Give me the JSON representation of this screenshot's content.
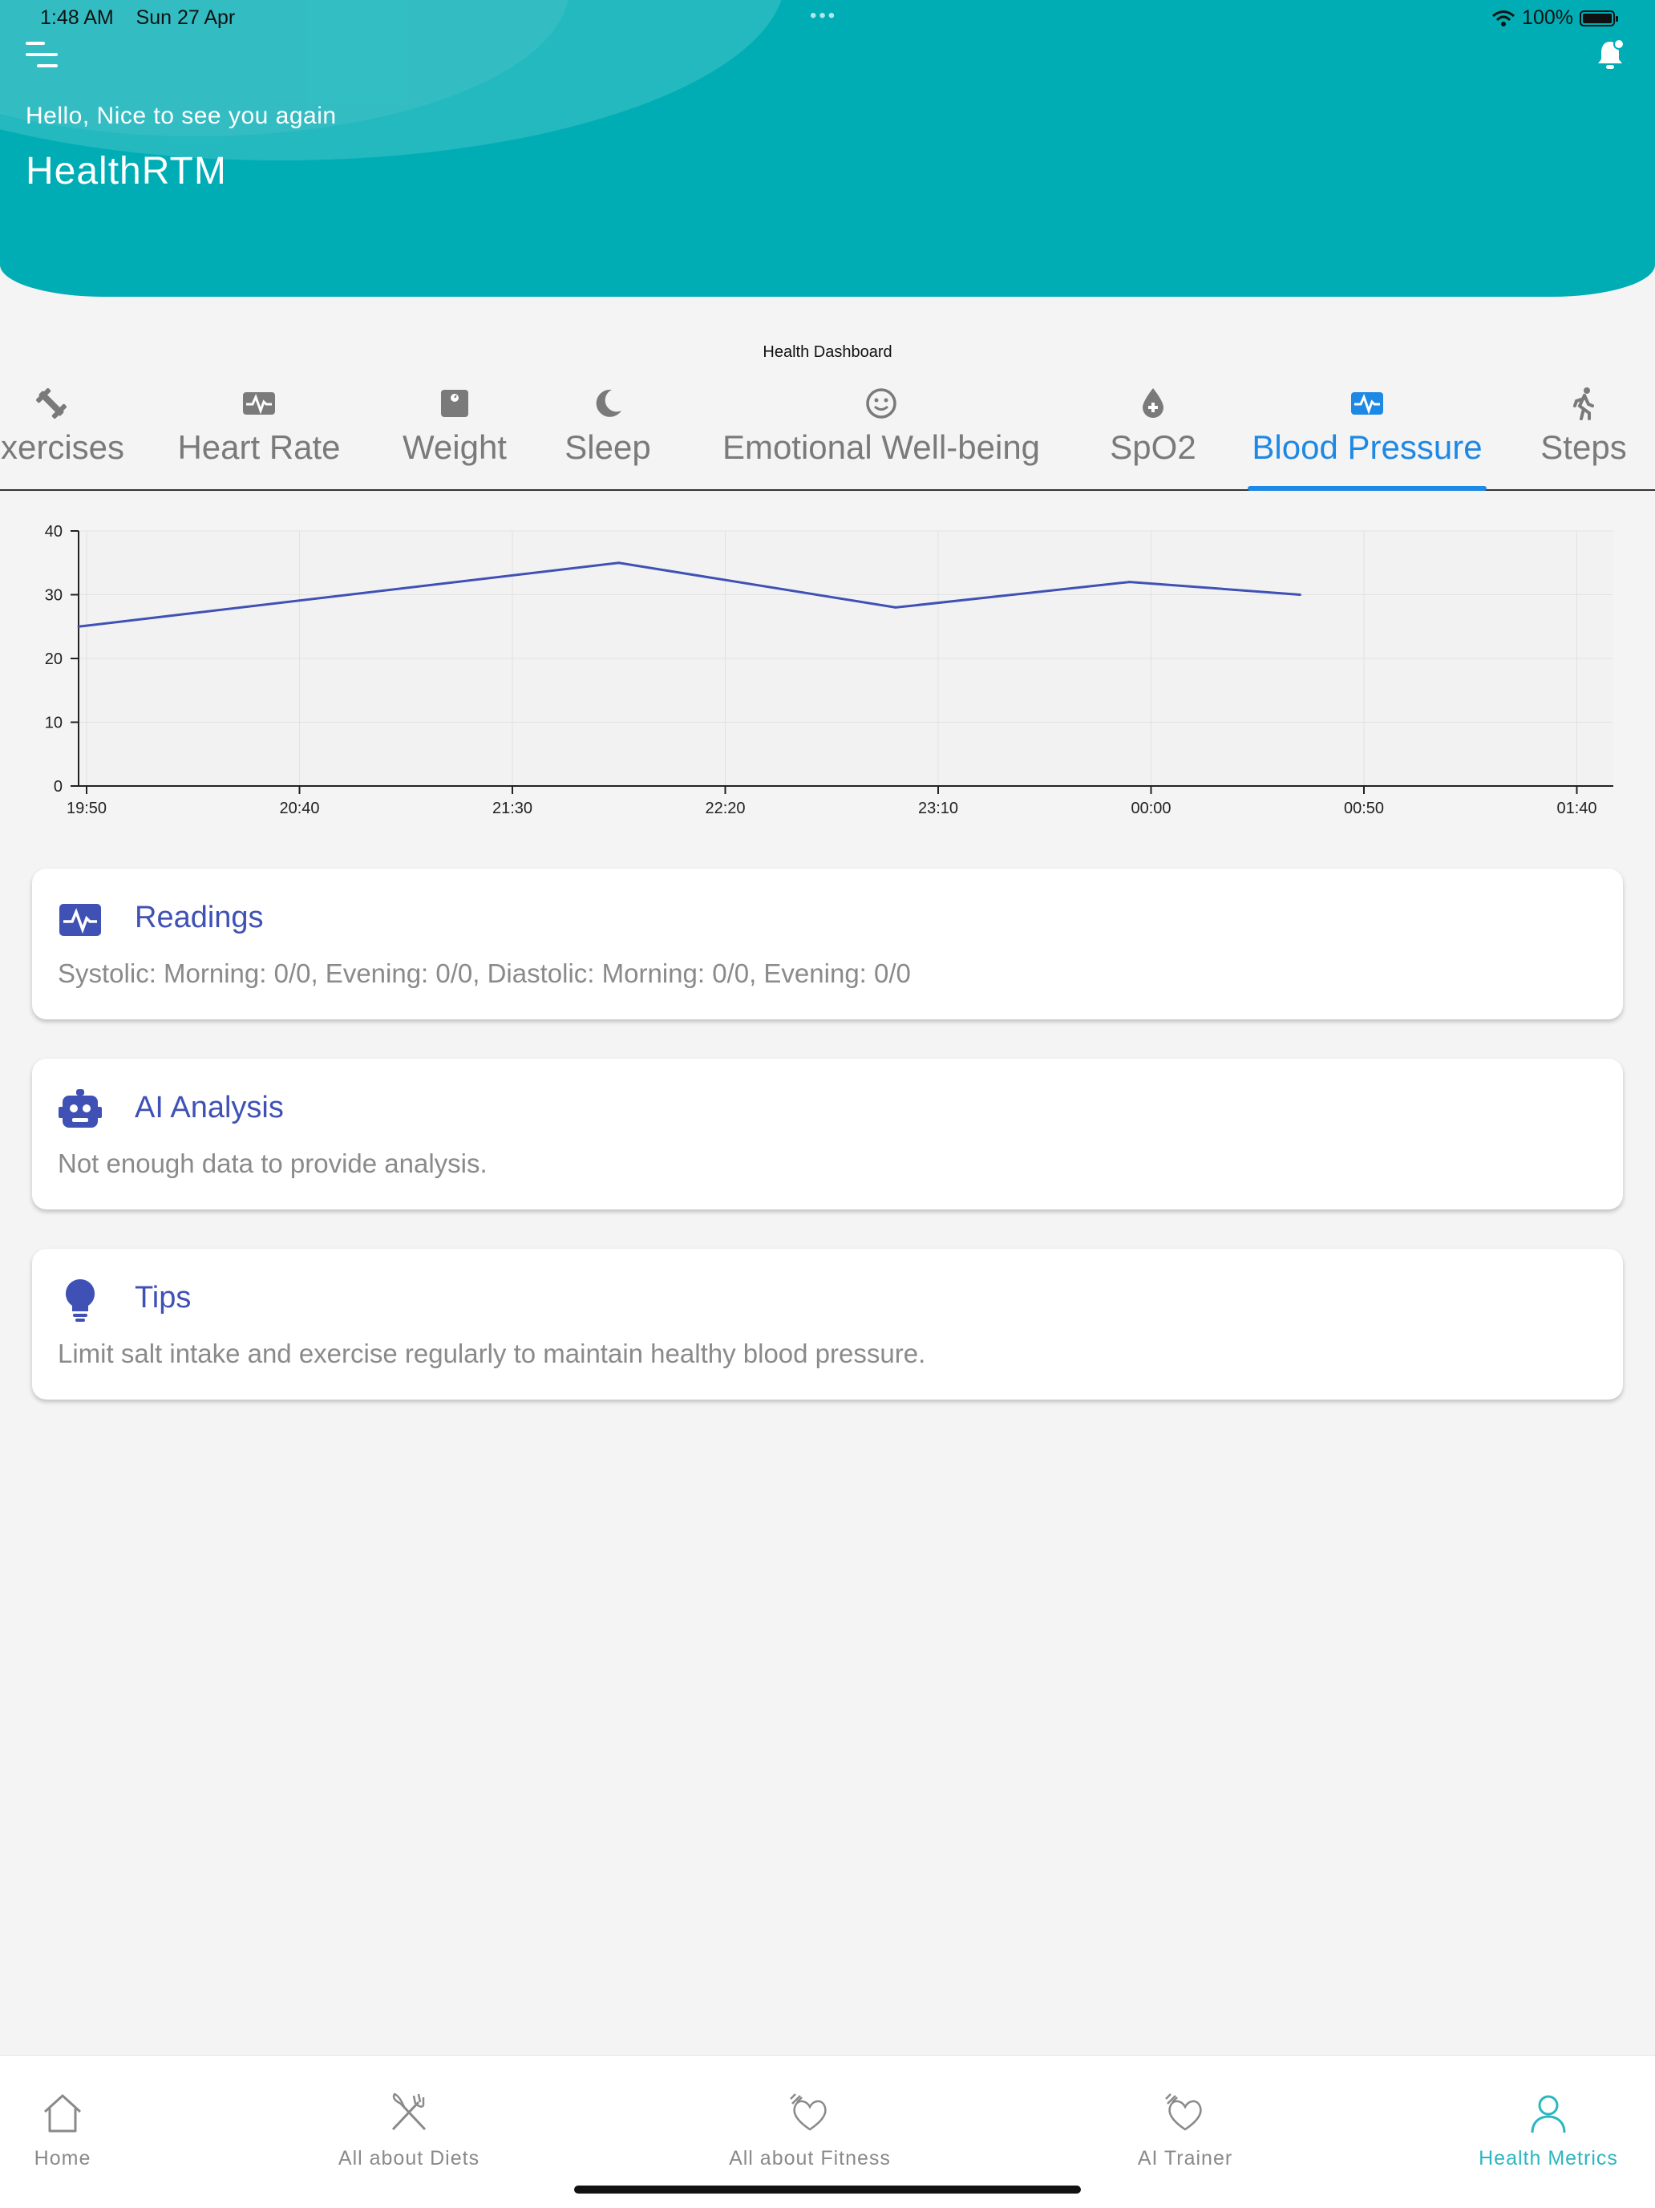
{
  "status_bar": {
    "time": "1:48 AM",
    "date": "Sun 27 Apr",
    "battery": "100%"
  },
  "header": {
    "greeting": "Hello, Nice to see you again",
    "title": "HealthRTM"
  },
  "dashboard": {
    "title": "Health Dashboard"
  },
  "tabs": [
    {
      "label": "Exercises",
      "icon": "dumbbell-icon"
    },
    {
      "label": "Heart Rate",
      "icon": "heart-monitor-icon"
    },
    {
      "label": "Weight",
      "icon": "scale-icon"
    },
    {
      "label": "Sleep",
      "icon": "moon-icon"
    },
    {
      "label": "Emotional Well-being",
      "icon": "smiley-icon"
    },
    {
      "label": "SpO2",
      "icon": "blood-drop-icon"
    },
    {
      "label": "Blood Pressure",
      "icon": "heart-monitor-icon",
      "active": true
    },
    {
      "label": "Steps",
      "icon": "walking-icon"
    }
  ],
  "colors": {
    "header": "#00adb5",
    "active_tab": "#1e88e5",
    "card_title": "#3f51b5",
    "line": "#3f51b5",
    "active_nav": "#2ab7c0"
  },
  "chart_data": {
    "type": "line",
    "x": [
      "19:50",
      "20:40",
      "21:30",
      "22:20",
      "23:10",
      "00:00",
      "00:50",
      "01:40"
    ],
    "series": [
      {
        "x": [
          "19:50",
          "21:55",
          "23:00",
          "23:55",
          "00:35"
        ],
        "values": [
          25,
          35,
          28,
          32,
          30
        ]
      }
    ],
    "ylim": [
      0,
      40
    ],
    "yticks": [
      0,
      10,
      20,
      30,
      40
    ],
    "grid": true
  },
  "cards": {
    "readings": {
      "title": "Readings",
      "text": "Systolic: Morning: 0/0, Evening: 0/0, Diastolic: Morning: 0/0, Evening: 0/0"
    },
    "analysis": {
      "title": "AI Analysis",
      "text": "Not enough data to provide analysis."
    },
    "tips": {
      "title": "Tips",
      "text": "Limit salt intake and exercise regularly to maintain healthy blood pressure."
    }
  },
  "nav": [
    {
      "label": "Home",
      "icon": "home-icon"
    },
    {
      "label": "All about Diets",
      "icon": "fork-knife-icon"
    },
    {
      "label": "All about Fitness",
      "icon": "fitness-heart-icon"
    },
    {
      "label": "AI Trainer",
      "icon": "trainer-icon"
    },
    {
      "label": "Health Metrics",
      "icon": "person-icon",
      "active": true
    }
  ]
}
